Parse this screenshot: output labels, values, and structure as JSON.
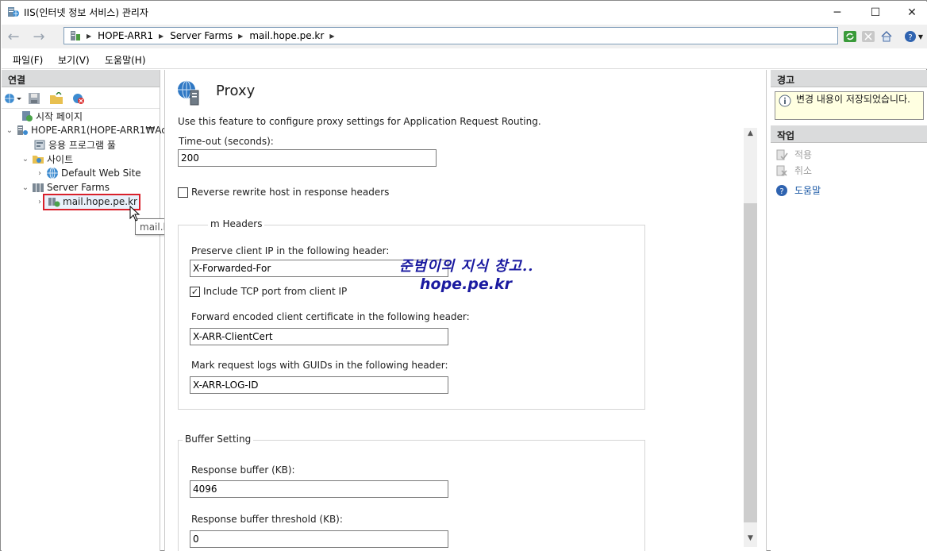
{
  "window": {
    "title": "IIS(인터넷 정보 서비스) 관리자",
    "minimize_glyph": "─",
    "maximize_glyph": "☐",
    "close_glyph": "✕"
  },
  "address": {
    "breadcrumbs": [
      "HOPE-ARR1",
      "Server Farms",
      "mail.hope.pe.kr"
    ],
    "back_glyph": "←",
    "forward_glyph": "→"
  },
  "menu": [
    "파일(F)",
    "보기(V)",
    "도움말(H)"
  ],
  "connections": {
    "header": "연결",
    "tree": [
      {
        "label": "시작 페이지",
        "level": 1,
        "icon": "start-page-icon"
      },
      {
        "label": "HOPE-ARR1(HOPE-ARR1₩Ac",
        "level": 0,
        "icon": "server-icon"
      },
      {
        "label": "응용 프로그램 풀",
        "level": 2,
        "icon": "app-pool-icon"
      },
      {
        "label": "사이트",
        "level": 1,
        "icon": "sites-folder-icon"
      },
      {
        "label": "Default Web Site",
        "level": 2,
        "icon": "globe-icon"
      },
      {
        "label": "Server Farms",
        "level": 1,
        "icon": "server-farms-icon"
      },
      {
        "label": "mail.hope.pe.kr",
        "level": 2,
        "icon": "server-farm-icon"
      }
    ],
    "tooltip": "mail.hope.pe.kr"
  },
  "feature": {
    "title": "Proxy",
    "description": "Use this feature to configure proxy settings for Application Request Routing.",
    "timeout_label": "Time-out (seconds):",
    "timeout_value": "200",
    "reverse_rewrite_label": "Reverse rewrite host in response headers",
    "reverse_rewrite_checked": false,
    "custom_headers": {
      "group_title": "m Headers",
      "preserve_ip_label": "Preserve client IP in the following header:",
      "preserve_ip_value": "X-Forwarded-For",
      "include_tcp_label": "Include TCP port from client IP",
      "include_tcp_checked": true,
      "client_cert_label": "Forward encoded client certificate in the following header:",
      "client_cert_value": "X-ARR-ClientCert",
      "guid_label": "Mark request logs with GUIDs in the following header:",
      "guid_value": "X-ARR-LOG-ID"
    },
    "buffer": {
      "group_title": "Buffer Setting",
      "response_buffer_label": "Response buffer (KB):",
      "response_buffer_value": "4096",
      "threshold_label": "Response buffer threshold (KB):",
      "threshold_value": "0"
    }
  },
  "alerts": {
    "header": "경고",
    "message": "변경 내용이 저장되었습니다."
  },
  "actions": {
    "header": "작업",
    "apply": "적용",
    "cancel": "취소",
    "help": "도움말"
  },
  "watermark": {
    "line1": "준범이의 지식 창고..",
    "line2": "hope.pe.kr"
  },
  "colors": {
    "selection_outline": "#d9202b",
    "pane_header": "#dadbdc",
    "link_blue": "#1c5aa6",
    "alert_bg": "#ffffe1",
    "watermark": "#1a1aa0"
  }
}
